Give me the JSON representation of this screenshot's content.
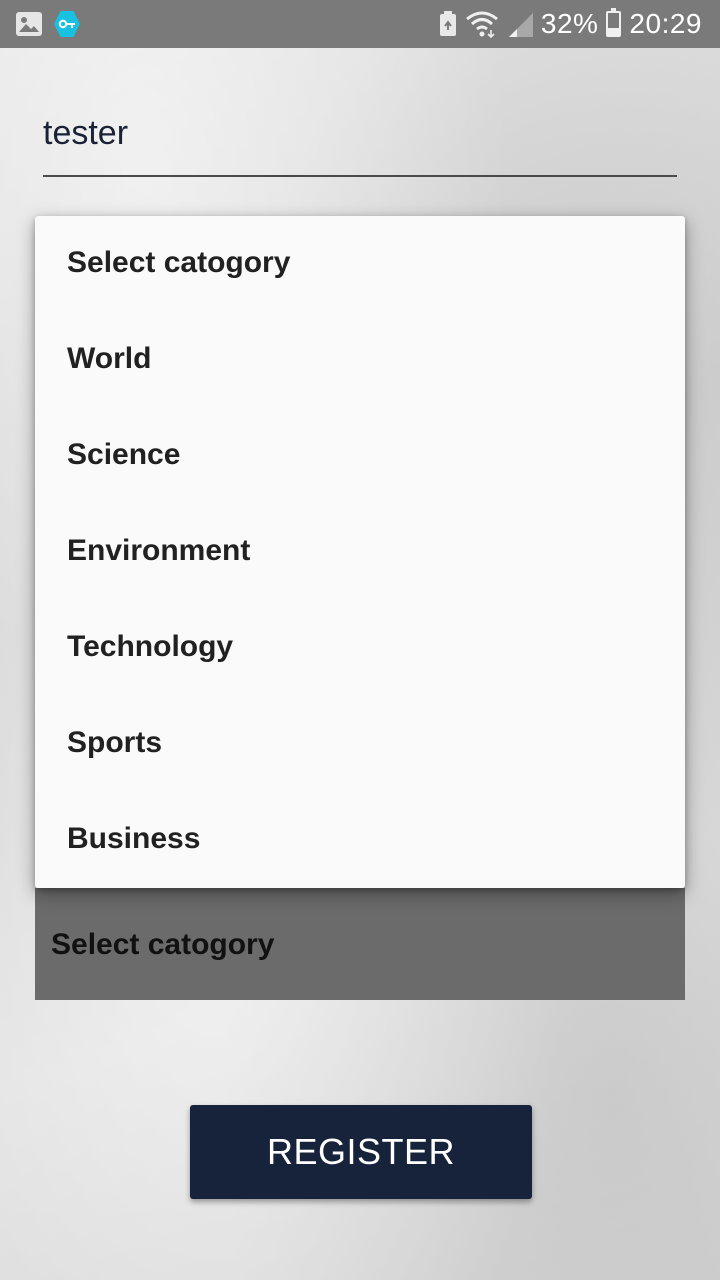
{
  "status_bar": {
    "left_icons": [
      "gallery-icon",
      "vpn-key-icon"
    ],
    "battery_percent": "32%",
    "time": "20:29",
    "right_icons": [
      "battery-saver-icon",
      "wifi-icon",
      "signal-icon",
      "battery-icon"
    ]
  },
  "form": {
    "username_value": "tester",
    "category_spinner_selected": "Select catogory",
    "register_label": "REGISTER"
  },
  "dropdown": {
    "options": [
      "Select catogory",
      "World",
      "Science",
      "Environment",
      "Technology",
      "Sports",
      "Business"
    ]
  },
  "colors": {
    "status_bar_bg": "#7a7a7a",
    "button_bg": "#17233b",
    "dropdown_bg": "#fafafa",
    "spinner_bg": "#6b6b6b",
    "accent_vpn": "#19c0e0"
  }
}
